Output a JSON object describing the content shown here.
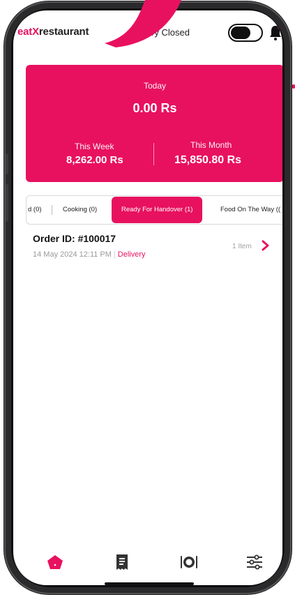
{
  "header": {
    "logo_prefix": "eat",
    "logo_mark": "X",
    "logo_suffix": "restaurant",
    "status_text": "porary Closed",
    "toggle_icon": "toggle-switch-icon",
    "bell_icon": "bell-icon"
  },
  "stats": {
    "today_label": "Today",
    "today_value": "0.00 Rs",
    "week_label": "This Week",
    "week_value": "8,262.00 Rs",
    "month_label": "This Month",
    "month_value": "15,850.80 Rs"
  },
  "tabs": [
    {
      "label": "d (0)"
    },
    {
      "label": "Cooking (0)"
    },
    {
      "label": "Ready For Handover (1)",
      "active": true
    },
    {
      "label": "Food On The Way (("
    }
  ],
  "order": {
    "id": "Order ID: #100017",
    "datetime": "14 May 2024  12:11 PM",
    "separator": "|",
    "type": "Delivery",
    "items": "1 Item"
  },
  "nav": [
    {
      "icon": "home-icon",
      "active": true
    },
    {
      "icon": "receipt-icon"
    },
    {
      "icon": "dish-icon"
    },
    {
      "icon": "settings-sliders-icon"
    }
  ],
  "colors": {
    "accent": "#e8115f",
    "text": "#111111",
    "muted": "#9a9a9a"
  }
}
